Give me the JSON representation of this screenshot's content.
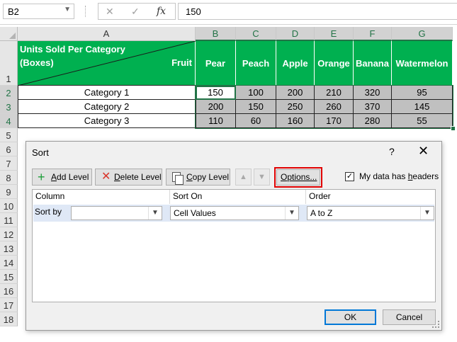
{
  "formula_bar": {
    "name_box": "B2",
    "cancel_glyph": "✕",
    "enter_glyph": "✓",
    "fx_glyph": "fx",
    "value": "150"
  },
  "columns": [
    "A",
    "B",
    "C",
    "D",
    "E",
    "F",
    "G"
  ],
  "rows": [
    "1",
    "2",
    "3",
    "4",
    "5",
    "6",
    "7",
    "8",
    "9",
    "10",
    "11",
    "12",
    "13",
    "14",
    "15",
    "16",
    "17",
    "18"
  ],
  "sheet": {
    "header_top_left": "Units Sold Per Category",
    "header_bottom_left": "(Boxes)",
    "header_right": "Fruit",
    "fruits": [
      "Pear",
      "Peach",
      "Apple",
      "Orange",
      "Banana",
      "Watermelon"
    ],
    "table": [
      {
        "category": "Category 1",
        "values": [
          "150",
          "100",
          "200",
          "210",
          "320",
          "95"
        ]
      },
      {
        "category": "Category 2",
        "values": [
          "200",
          "150",
          "250",
          "260",
          "370",
          "145"
        ]
      },
      {
        "category": "Category 3",
        "values": [
          "110",
          "60",
          "160",
          "170",
          "280",
          "55"
        ]
      }
    ],
    "header_color": "#00b050",
    "data_fill": "#c0c0c0"
  },
  "dialog": {
    "title": "Sort",
    "help": "?",
    "close": "✕",
    "add_level": {
      "accel": "A",
      "rest": "dd Level"
    },
    "delete_level": {
      "accel": "D",
      "rest": "elete Level"
    },
    "copy_level": {
      "accel": "C",
      "rest": "opy Level"
    },
    "move_up": "▲",
    "move_down": "▼",
    "options": {
      "accel": "O",
      "rest": "ptions..."
    },
    "headers_checkbox": {
      "label_pre": "My data has ",
      "accel": "h",
      "label_post": "eaders",
      "checked": "✓"
    },
    "column_headers": {
      "column": "Column",
      "sort_on": "Sort On",
      "order": "Order"
    },
    "level": {
      "label": "Sort by",
      "column_value": "",
      "sort_on_value": "Cell Values",
      "order_value": "A to Z"
    },
    "ok": "OK",
    "cancel": "Cancel",
    "highlight_color": "#e00000"
  }
}
